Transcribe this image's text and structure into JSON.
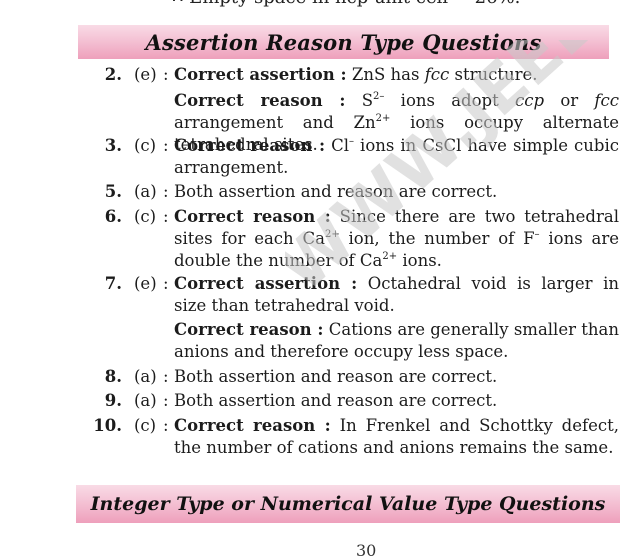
{
  "top_line": "∴ Empty space in hcp unit cell = 26%.",
  "heading_assertion_reason": "Assertion Reason Type Questions",
  "heading_integer": "Integer Type or Numerical Value Type Questions",
  "watermark_text": "WWW.JEEBOOKS.IN",
  "answers": [
    {
      "number": "2.",
      "option": "(e)",
      "paragraphs": [
        {
          "label": "Correct assertion :",
          "text": " ZnS has ",
          "it": "fcc",
          "tail": " structure."
        },
        {
          "label": "Correct reason :",
          "s1": " S",
          "sup1": "2–",
          "s2": " ions adopt ",
          "it1": "ccp",
          "s3": " or ",
          "it2": "fcc",
          "s4": " arrangement and Zn",
          "sup2": "2+",
          "s5": " ions occupy alternate tetrahedral sites."
        }
      ]
    },
    {
      "number": "3.",
      "option": "(c)",
      "label": "Correct reason :",
      "s1": " Cl",
      "sup1": "–",
      "s2": " ions in CsCl have simple cubic arrangement."
    },
    {
      "number": "5.",
      "option": "(a)",
      "text": "Both assertion and reason are correct."
    },
    {
      "number": "6.",
      "option": "(c)",
      "label": "Correct reason :",
      "s1": " Since there are two tetrahedral sites for each Ca",
      "sup1": "2+",
      "s2": " ion, the number of F",
      "sup2": "–",
      "s3": " ions are double the number of Ca",
      "sup3": "2+",
      "s4": " ions."
    },
    {
      "number": "7.",
      "option": "(e)",
      "paragraphs": [
        {
          "label": "Correct assertion :",
          "text": " Octahedral void is larger in size than tetrahedral void."
        },
        {
          "label": "Correct reason :",
          "text": " Cations are generally smaller than anions and therefore occupy less space."
        }
      ]
    },
    {
      "number": "8.",
      "option": "(a)",
      "text": "Both assertion and reason are correct."
    },
    {
      "number": "9.",
      "option": "(a)",
      "text": "Both assertion and reason are correct."
    },
    {
      "number": "10.",
      "option": "(c)",
      "label": "Correct reason :",
      "text": " In Frenkel and Schottky defect, the number of cations and anions remains the same."
    }
  ],
  "page_number": "30"
}
